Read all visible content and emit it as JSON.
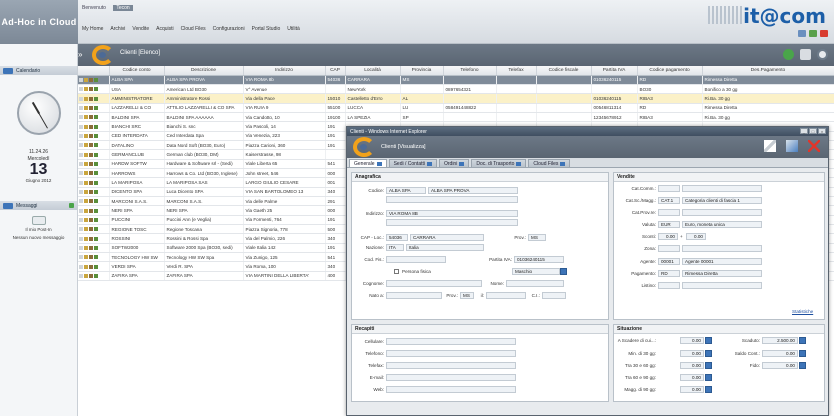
{
  "brand": "Ad-Hoc in Cloud",
  "user_line": {
    "label": "Benvenuto",
    "user": "Tecon"
  },
  "top_menu": [
    "My Home",
    "Archivi",
    "Vendite",
    "Acquisti",
    "Cloud Files",
    "Configurazioni",
    "Portal Studio",
    "Utilità"
  ],
  "logo": "it@com",
  "page_title": "Clienti [Elenco]",
  "sidebar": {
    "calendar_label": "Calendario",
    "time": "11.24.26",
    "weekday": "Mercoledì",
    "day": "13",
    "month_year": "Giugno 2012",
    "messages_label": "Messaggi",
    "mail_text": "Il mio Post-In",
    "no_messages": "Nessun nuovo messaggio"
  },
  "grid": {
    "columns": [
      "",
      "Codice conto",
      "Descrizione",
      "Indirizzo",
      "CAP",
      "Località",
      "Provincia",
      "Telefono",
      "Telefax",
      "Codice fiscale",
      "Partita IVA",
      "Codice pagamento",
      "Des.Pagamento"
    ],
    "rows": [
      [
        "ALBA SPA",
        "ALBA SPA PROVA",
        "VIA ROMA 8b",
        "54036",
        "CARRARA",
        "MS",
        "",
        "",
        "",
        "01036240115",
        "RD",
        "Rimessa Diretta"
      ],
      [
        "USA",
        "American Ltd BO30",
        "V° Avenue",
        "",
        "NewYork",
        "",
        "0897654321",
        "",
        "",
        "",
        "BO30",
        "Bonifico a 30 gg"
      ],
      [
        "AMMINISTRATORE",
        "Amministratore Rossi",
        "Via della Pace",
        "15010",
        "Castelletto d'Erro",
        "AL",
        "",
        "",
        "",
        "01036240115",
        "RIBA3",
        "Ri.Ba. 30 gg"
      ],
      [
        "LAZZARELLI & CO",
        "ATTILIO LAZZARELLI & CO SPA",
        "VIA RUIA 9",
        "55100",
        "LUCCA",
        "LU",
        "058491448822",
        "",
        "",
        "00546811314",
        "RD",
        "Rimessa Diretta"
      ],
      [
        "BALDINI SPA",
        "BALDINI SPA AAAAAA",
        "Via Candotto, 10",
        "19100",
        "LA SPEZIA",
        "SP",
        "",
        "",
        "",
        "12345678912",
        "RIBA3",
        "Ri.Ba. 30 gg"
      ],
      [
        "BIANCHI SRC",
        "Bianchi S. snc",
        "Via Pascoli, 14",
        "191",
        "",
        "",
        "",
        "",
        "",
        "",
        "",
        ""
      ],
      [
        "CED INTERDATA",
        "Ced Interdata Spa",
        "Via Venezia, 223",
        "191",
        "",
        "",
        "",
        "",
        "",
        "",
        "",
        ""
      ],
      [
        "DATALINO",
        "Data Nord Soft (BO30, Euro)",
        "Piazza Carioni, 360",
        "191",
        "",
        "",
        "",
        "",
        "",
        "",
        "",
        ""
      ],
      [
        "GERMANCLUB",
        "German club (BO30, DM)",
        "Kaiserstrasse, 98",
        "",
        "",
        "",
        "",
        "",
        "",
        "",
        "",
        ""
      ],
      [
        "HARDW SOFTW",
        "Hardware & Software srl - (Sedi)",
        "Viale Liberta 65",
        "541",
        "",
        "",
        "",
        "",
        "",
        "",
        "",
        ""
      ],
      [
        "HARROWS",
        "Harrows & Co. Ltd (BO30, Inglese)",
        "John street, 546",
        "000",
        "",
        "",
        "",
        "",
        "",
        "",
        "",
        ""
      ],
      [
        "LA MARIPOSA",
        "LA MARIPOSA SAS",
        "LARGO GIULIO CESARE",
        "001",
        "",
        "",
        "",
        "",
        "",
        "",
        "",
        ""
      ],
      [
        "DICENTO SPA",
        "Luca Dicento SPA",
        "VIA SAN BARTOLOMEO 13",
        "340",
        "",
        "",
        "",
        "",
        "",
        "",
        "",
        ""
      ],
      [
        "MARCONI S.A.S.",
        "MARCONI S.A.S.",
        "Via delle Palme",
        "291",
        "",
        "",
        "",
        "",
        "",
        "",
        "",
        ""
      ],
      [
        "NERI SPA",
        "NERI SPA",
        "Via Gaeth 25",
        "000",
        "",
        "",
        "",
        "",
        "",
        "",
        "",
        ""
      ],
      [
        "PUCCINI",
        "Puccini Ann (e Veglia)",
        "Via Formenti, 764",
        "191",
        "",
        "",
        "",
        "",
        "",
        "",
        "",
        ""
      ],
      [
        "REGIONE TOSC",
        "Regione Toscana",
        "Piazza Signoria, 778",
        "500",
        "",
        "",
        "",
        "",
        "",
        "",
        "",
        ""
      ],
      [
        "ROSSINI",
        "Rossini & Rossi Spa",
        "Via del Palmio, 226",
        "340",
        "",
        "",
        "",
        "",
        "",
        "",
        "",
        ""
      ],
      [
        "SOFTW2000",
        "Software 2000 Spa (BO30, sedi)",
        "Viale Italia 142",
        "191",
        "",
        "",
        "",
        "",
        "",
        "",
        "",
        ""
      ],
      [
        "TECNOLOGY HW SW",
        "Tecnology HW SW Spa",
        "Via Zunigo, 125",
        "541",
        "",
        "",
        "",
        "",
        "",
        "",
        "",
        ""
      ],
      [
        "VERDI SPA",
        "Verdi R. SPA",
        "Via Roma, 100",
        "340",
        "",
        "",
        "",
        "",
        "",
        "",
        "",
        ""
      ],
      [
        "ZAFIRA SPA",
        "ZAFIRA SPA",
        "VIA MARTINI DELLA LIBERTA'",
        "400",
        "",
        "",
        "",
        "",
        "",
        "",
        "",
        ""
      ]
    ]
  },
  "modal": {
    "window_title": "Clienti - Windows Internet Explorer",
    "title": "Clienti [Visualizza]",
    "tabs": [
      "Generale",
      "Sedi / Contatti",
      "Ordini",
      "Doc. di Trasporto",
      "Cloud Files"
    ],
    "anagrafica": {
      "title": "Anagrafica",
      "codice_label": "Codice:",
      "codice": "ALBA SPA",
      "descrizione": "ALBA SPA PROVA",
      "indirizzo_label": "Indirizzo:",
      "indirizzo": "VIA ROMA 8B",
      "cap_label": "CAP - Loc.:",
      "cap": "54036",
      "localita": "CARRARA",
      "prov_label": "Prov.:",
      "prov": "MS",
      "nazione_label": "Nazione:",
      "nazione_code": "ITA",
      "nazione": "Italia",
      "codfis_label": "Cod. Fis.:",
      "partita_label": "Partita IVA:",
      "partita_iva": "01036240115",
      "persona_fisica": "Persona fisica",
      "sesso": "Maschio",
      "cognome_label": "Cognome:",
      "nome_label": "Nome:",
      "nato_label": "Nato a:",
      "nato_prov_label": "Prov.:",
      "nato_prov": "MS",
      "il_label": "il:",
      "cl_label": "C.I.:"
    },
    "vendite": {
      "title": "Vendite",
      "cat_comm_label": "Cat.Comm.:",
      "cat_sc_label": "Cat.Sc./Magg.:",
      "cat_sc_code": "CAT.1",
      "cat_sc": "Categoria clienti di fascia 1",
      "cat_prov_label": "Cat.Prov.re:",
      "valuta_label": "Valuta:",
      "valuta_code": "EUR",
      "valuta": "Euro, moneta unica",
      "sconti_label": "Sconti:",
      "sconto1": "0.00",
      "sconto2": "0.00",
      "zona_label": "Zona:",
      "agente_label": "Agente:",
      "agente_code": "00001",
      "agente": "Agente 00001",
      "pagamento_label": "Pagamento:",
      "pagamento_code": "RD",
      "pagamento": "Rimessa Diretta",
      "listino_label": "Listino:",
      "statistiche": "Statistiche"
    },
    "recapiti": {
      "title": "Recapiti",
      "labels": [
        "Cellulare:",
        "Telefono:",
        "Telefax:",
        "E-mail:",
        "Web:"
      ]
    },
    "situazione": {
      "title": "Situazione",
      "left": [
        {
          "label": "A Scadere di cui...:",
          "value": "0.00"
        },
        {
          "label": "Min. di 30 gg:",
          "value": "0.00"
        },
        {
          "label": "Tra 30 e 60 gg:",
          "value": "0.00"
        },
        {
          "label": "Tra 60 e 90 gg:",
          "value": "0.00"
        },
        {
          "label": "Magg. di 90 gg:",
          "value": "0.00"
        }
      ],
      "right": [
        {
          "label": "Scaduto:",
          "value": "2.500.00"
        },
        {
          "label": "Saldo Cont.:",
          "value": "0.00"
        },
        {
          "label": "Fido:",
          "value": "0.00"
        }
      ]
    }
  }
}
